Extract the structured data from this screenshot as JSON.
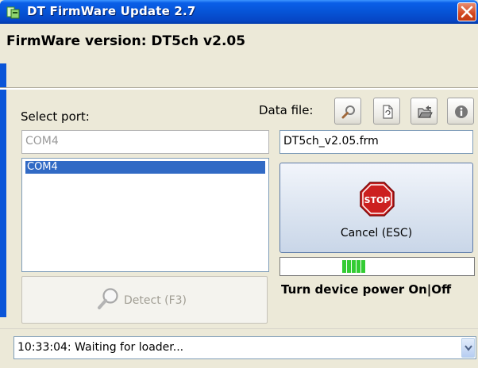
{
  "window": {
    "title": "DT FirmWare Update 2.7"
  },
  "firmware": {
    "label": "FirmWare version: DT5ch v2.05"
  },
  "port": {
    "label": "Select port:",
    "value": "COM4",
    "list": [
      "COM4"
    ],
    "detect_label": "Detect (F3)"
  },
  "data_file": {
    "label": "Data file:",
    "value": "DT5ch_v2.05.frm",
    "tools": [
      "search-icon",
      "document-icon",
      "open-folder-icon",
      "info-icon"
    ]
  },
  "cancel": {
    "label": "Cancel (ESC)",
    "stop_text": "STOP"
  },
  "progress": {
    "filled_blocks": 5,
    "accent": "#33cc33"
  },
  "power_text": "Turn device power On|Off",
  "status": {
    "text": "10:33:04: Waiting for loader..."
  },
  "colors": {
    "title_bar": "#0654d6",
    "selection": "#316ac5",
    "stop_red": "#cc1f1f"
  }
}
